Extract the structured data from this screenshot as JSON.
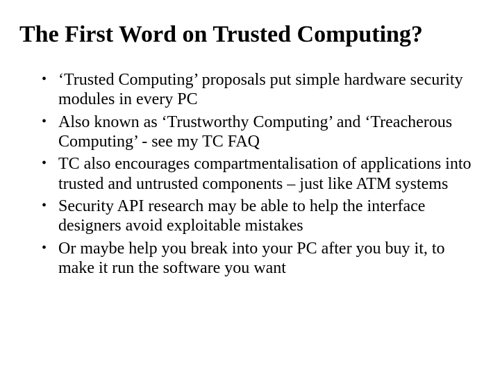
{
  "title": "The First Word on Trusted Computing?",
  "bullets": [
    "‘Trusted Computing’ proposals put simple hardware security modules in every PC",
    "Also known as ‘Trustworthy Computing’ and ‘Treacherous Computing’ - see my TC FAQ",
    "TC also encourages compartmentalisation of applications into trusted and untrusted components – just like ATM systems",
    "Security API research may be able to help the interface designers avoid exploitable mistakes",
    "Or maybe help you break into your PC after you buy it, to make it run the software you want"
  ]
}
